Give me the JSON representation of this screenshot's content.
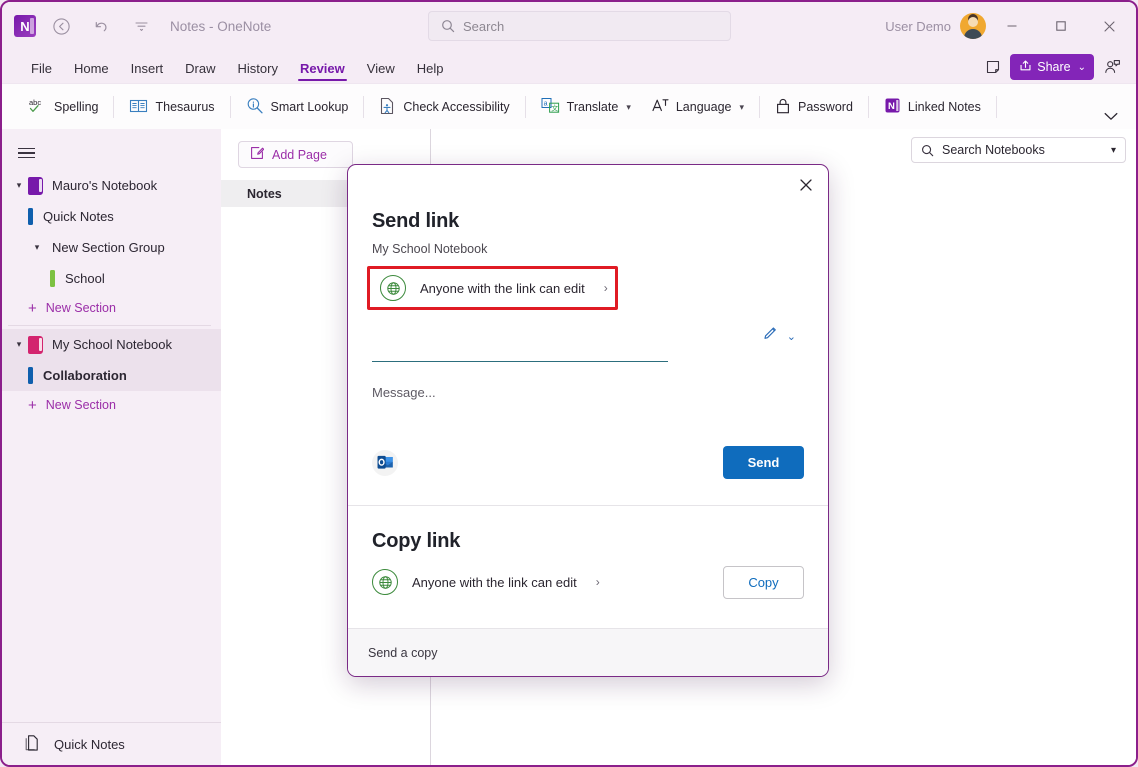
{
  "window": {
    "title": "Notes  -  OneNote",
    "app_logo_letter": "N",
    "back_icon": "back-arrow-icon",
    "undo_icon": "undo-icon",
    "customize_icon": "customize-quick-access-icon",
    "minimize_label": "—",
    "maximize_label": "□",
    "close_label": "✕"
  },
  "search": {
    "placeholder": "Search",
    "icon": "search-icon"
  },
  "account": {
    "user_name": "User Demo",
    "avatar": "user-avatar"
  },
  "ribbon_tabs": [
    {
      "label": "File",
      "active": false
    },
    {
      "label": "Home",
      "active": false
    },
    {
      "label": "Insert",
      "active": false
    },
    {
      "label": "Draw",
      "active": false
    },
    {
      "label": "History",
      "active": false
    },
    {
      "label": "Review",
      "active": true
    },
    {
      "label": "View",
      "active": false
    },
    {
      "label": "Help",
      "active": false
    }
  ],
  "tab_actions": {
    "notes_pane_icon": "notes-page-icon",
    "share_label": "Share",
    "share_icon": "share-icon",
    "share_chevron": "⌄",
    "comment_icon": "comment-person-icon",
    "share_color": "#8325b8"
  },
  "ribbon": {
    "items": [
      {
        "label": "Spelling",
        "icon": "spelling-abc-icon",
        "chevron": false,
        "sep_after": true
      },
      {
        "label": "Thesaurus",
        "icon": "thesaurus-book-icon",
        "chevron": false,
        "sep_after": true
      },
      {
        "label": "Smart Lookup",
        "icon": "smart-lookup-icon",
        "chevron": false,
        "sep_after": true
      },
      {
        "label": "Check Accessibility",
        "icon": "check-accessibility-icon",
        "chevron": false,
        "sep_after": true
      },
      {
        "label": "Translate",
        "icon": "translate-icon",
        "chevron": true,
        "sep_after": false
      },
      {
        "label": "Language",
        "icon": "language-icon",
        "chevron": true,
        "sep_after": true
      },
      {
        "label": "Password",
        "icon": "lock-icon",
        "chevron": false,
        "sep_after": true
      },
      {
        "label": "Linked Notes",
        "icon": "onenote-linked-notes-icon",
        "chevron": false,
        "sep_after": true
      }
    ],
    "collapse_icon": "chevron-down-icon"
  },
  "sidebar": {
    "menu_icon": "hamburger-menu-icon",
    "items": [
      {
        "label": "Mauro's Notebook",
        "type": "notebook",
        "color": "purple",
        "expanded": true,
        "selected": false,
        "bold": false,
        "indent": 0
      },
      {
        "label": "Quick Notes",
        "type": "section",
        "color": "blue",
        "selected": false,
        "bold": false,
        "indent": 1
      },
      {
        "label": "New Section Group",
        "type": "group",
        "expanded": true,
        "selected": false,
        "bold": false,
        "indent": 1
      },
      {
        "label": "School",
        "type": "section",
        "color": "green",
        "selected": false,
        "bold": false,
        "indent": 2
      },
      {
        "label": "New Section",
        "type": "new",
        "indent": 1
      },
      {
        "label": "My  School Notebook",
        "type": "notebook",
        "color": "pink",
        "expanded": true,
        "selected": true,
        "bold": false,
        "indent": 0
      },
      {
        "label": "Collaboration",
        "type": "section",
        "color": "blue",
        "selected": true,
        "bold": true,
        "indent": 1
      },
      {
        "label": "New Section",
        "type": "new",
        "indent": 1
      }
    ],
    "footer": {
      "label": "Quick Notes",
      "icon": "quick-notes-page-icon"
    }
  },
  "pagelist": {
    "add_page_label": "Add Page",
    "add_page_icon": "add-page-icon",
    "pages": [
      {
        "label": "Notes",
        "selected": true
      }
    ]
  },
  "content": {
    "expand_icon": "expand-diagonal-icon",
    "search_notebooks": {
      "placeholder": "Search Notebooks",
      "icon": "search-icon",
      "chevron": "⌄"
    }
  },
  "share_dialog": {
    "close_icon": "close-icon",
    "send_link": {
      "title": "Send link",
      "subtitle": "My School Notebook",
      "permission_label": "Anyone with the link can edit",
      "permission_arrow": "›",
      "permission_icon": "globe-icon",
      "highlight_color": "#e01b24",
      "recipient_value": "",
      "recipient_placeholder": "",
      "pencil_icon": "pencil-edit-icon",
      "pencil_chevron": "⌄",
      "message_placeholder": "Message...",
      "outlook_icon": "outlook-icon",
      "send_label": "Send",
      "send_color": "#0f6cbd"
    },
    "copy_link": {
      "title": "Copy link",
      "permission_label": "Anyone with the link can edit",
      "permission_arrow": "›",
      "permission_icon": "globe-icon",
      "copy_label": "Copy"
    },
    "footer": {
      "label": "Send a copy"
    }
  }
}
